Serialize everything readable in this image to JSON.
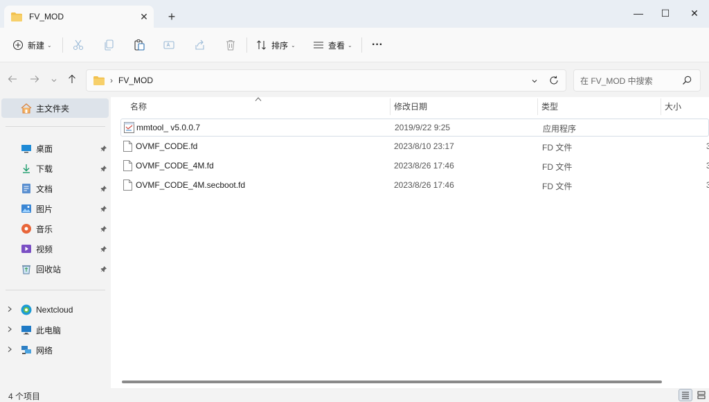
{
  "tab": {
    "title": "FV_MOD",
    "close": "✕",
    "new_tab": "+"
  },
  "window_controls": {
    "minimize": "—",
    "maximize": "☐",
    "close": "✕"
  },
  "toolbar": {
    "new_label": "新建",
    "sort_label": "排序",
    "view_label": "查看",
    "more": "···",
    "caret": "⌄"
  },
  "address": {
    "path_sep": "›",
    "folder": "FV_MOD",
    "search_placeholder": "在 FV_MOD 中搜索"
  },
  "sidebar": {
    "home": "主文件夹",
    "pinned": [
      {
        "label": "桌面",
        "icon": "desktop-icon"
      },
      {
        "label": "下载",
        "icon": "download-icon"
      },
      {
        "label": "文档",
        "icon": "documents-icon"
      },
      {
        "label": "图片",
        "icon": "pictures-icon"
      },
      {
        "label": "音乐",
        "icon": "music-icon"
      },
      {
        "label": "视频",
        "icon": "videos-icon"
      },
      {
        "label": "回收站",
        "icon": "recycle-bin-icon"
      }
    ],
    "locations": [
      {
        "label": "Nextcloud",
        "icon": "nextcloud-icon"
      },
      {
        "label": "此电脑",
        "icon": "this-pc-icon"
      },
      {
        "label": "网络",
        "icon": "network-icon"
      }
    ]
  },
  "columns": {
    "name": "名称",
    "modified": "修改日期",
    "type": "类型",
    "size": "大小"
  },
  "files": [
    {
      "name": "mmtool_ v5.0.0.7",
      "date": "2019/9/22 9:25",
      "type": "应用程序",
      "size": "",
      "icon": "application-icon"
    },
    {
      "name": "OVMF_CODE.fd",
      "date": "2023/8/10 23:17",
      "type": "FD 文件",
      "size": "3",
      "icon": "file-icon"
    },
    {
      "name": "OVMF_CODE_4M.fd",
      "date": "2023/8/26 17:46",
      "type": "FD 文件",
      "size": "3",
      "icon": "file-icon"
    },
    {
      "name": "OVMF_CODE_4M.secboot.fd",
      "date": "2023/8/26 17:46",
      "type": "FD 文件",
      "size": "3",
      "icon": "file-icon"
    }
  ],
  "status": {
    "item_count": "4 个项目"
  },
  "colors": {
    "folder": "#f2c14e",
    "selected_bg": "#dde3ea",
    "accent": "#0067c0"
  }
}
